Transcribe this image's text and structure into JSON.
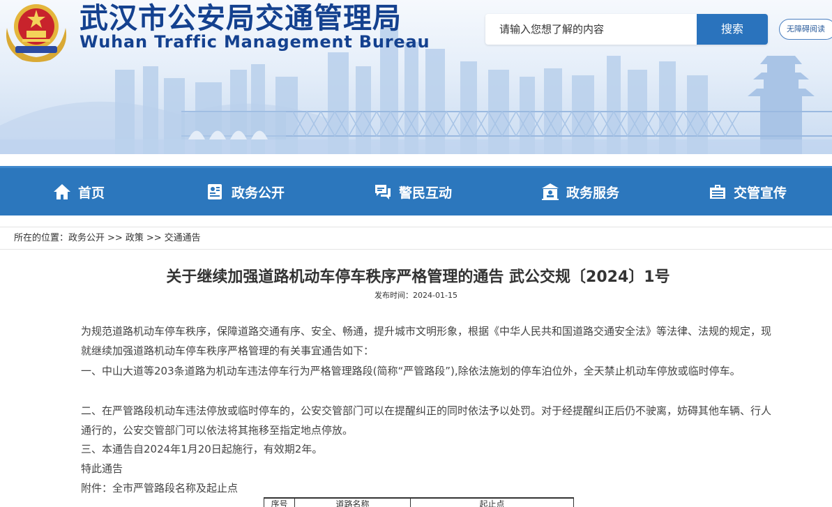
{
  "header": {
    "title_cn": "武汉市公安局交通管理局",
    "title_en": "Wuhan Traffic Management Bureau",
    "search_placeholder": "请输入您想了解的内容",
    "search_button": "搜索",
    "accessibility_button": "无障碍阅读",
    "colors": {
      "brand": "#14418f",
      "nav": "#2c77bd",
      "button": "#2a73bd"
    }
  },
  "nav": {
    "items": [
      {
        "label": "首页",
        "icon": "home-icon"
      },
      {
        "label": "政务公开",
        "icon": "document-badge-icon"
      },
      {
        "label": "警民互动",
        "icon": "chat-icon"
      },
      {
        "label": "政务服务",
        "icon": "service-icon"
      },
      {
        "label": "交管宣传",
        "icon": "briefcase-icon"
      }
    ]
  },
  "breadcrumb": {
    "prefix": "所在的位置：",
    "items": [
      "政务公开",
      "政策",
      "交通通告"
    ],
    "separator": ">>"
  },
  "article": {
    "title": "关于继续加强道路机动车停车秩序严格管理的通告 武公交规〔2024〕1号",
    "date_label": "发布时间：",
    "date": "2024-01-15",
    "paragraphs": [
      "为规范道路机动车停车秩序，保障道路交通有序、安全、畅通，提升城市文明形象，根据《中华人民共和国道路交通安全法》等法律、法规的规定，现就继续加强道路机动车停车秩序严格管理的有关事宜通告如下：",
      "一、中山大道等203条道路为机动车违法停车行为严格管理路段(简称“严管路段”),除依法施划的停车泊位外，全天禁止机动车停放或临时停车。",
      "二、在严管路段机动车违法停放或临时停车的，公安交管部门可以在提醒纠正的同时依法予以处罚。对于经提醒纠正后仍不驶离，妨碍其他车辆、行人通行的，公安交管部门可以依法将其拖移至指定地点停放。",
      "三、本通告自2024年1月20日起施行，有效期2年。",
      "特此通告",
      "附件：全市严管路段名称及起止点"
    ],
    "table": {
      "headers": [
        "序号",
        "道路名称",
        "起止点"
      ]
    }
  }
}
